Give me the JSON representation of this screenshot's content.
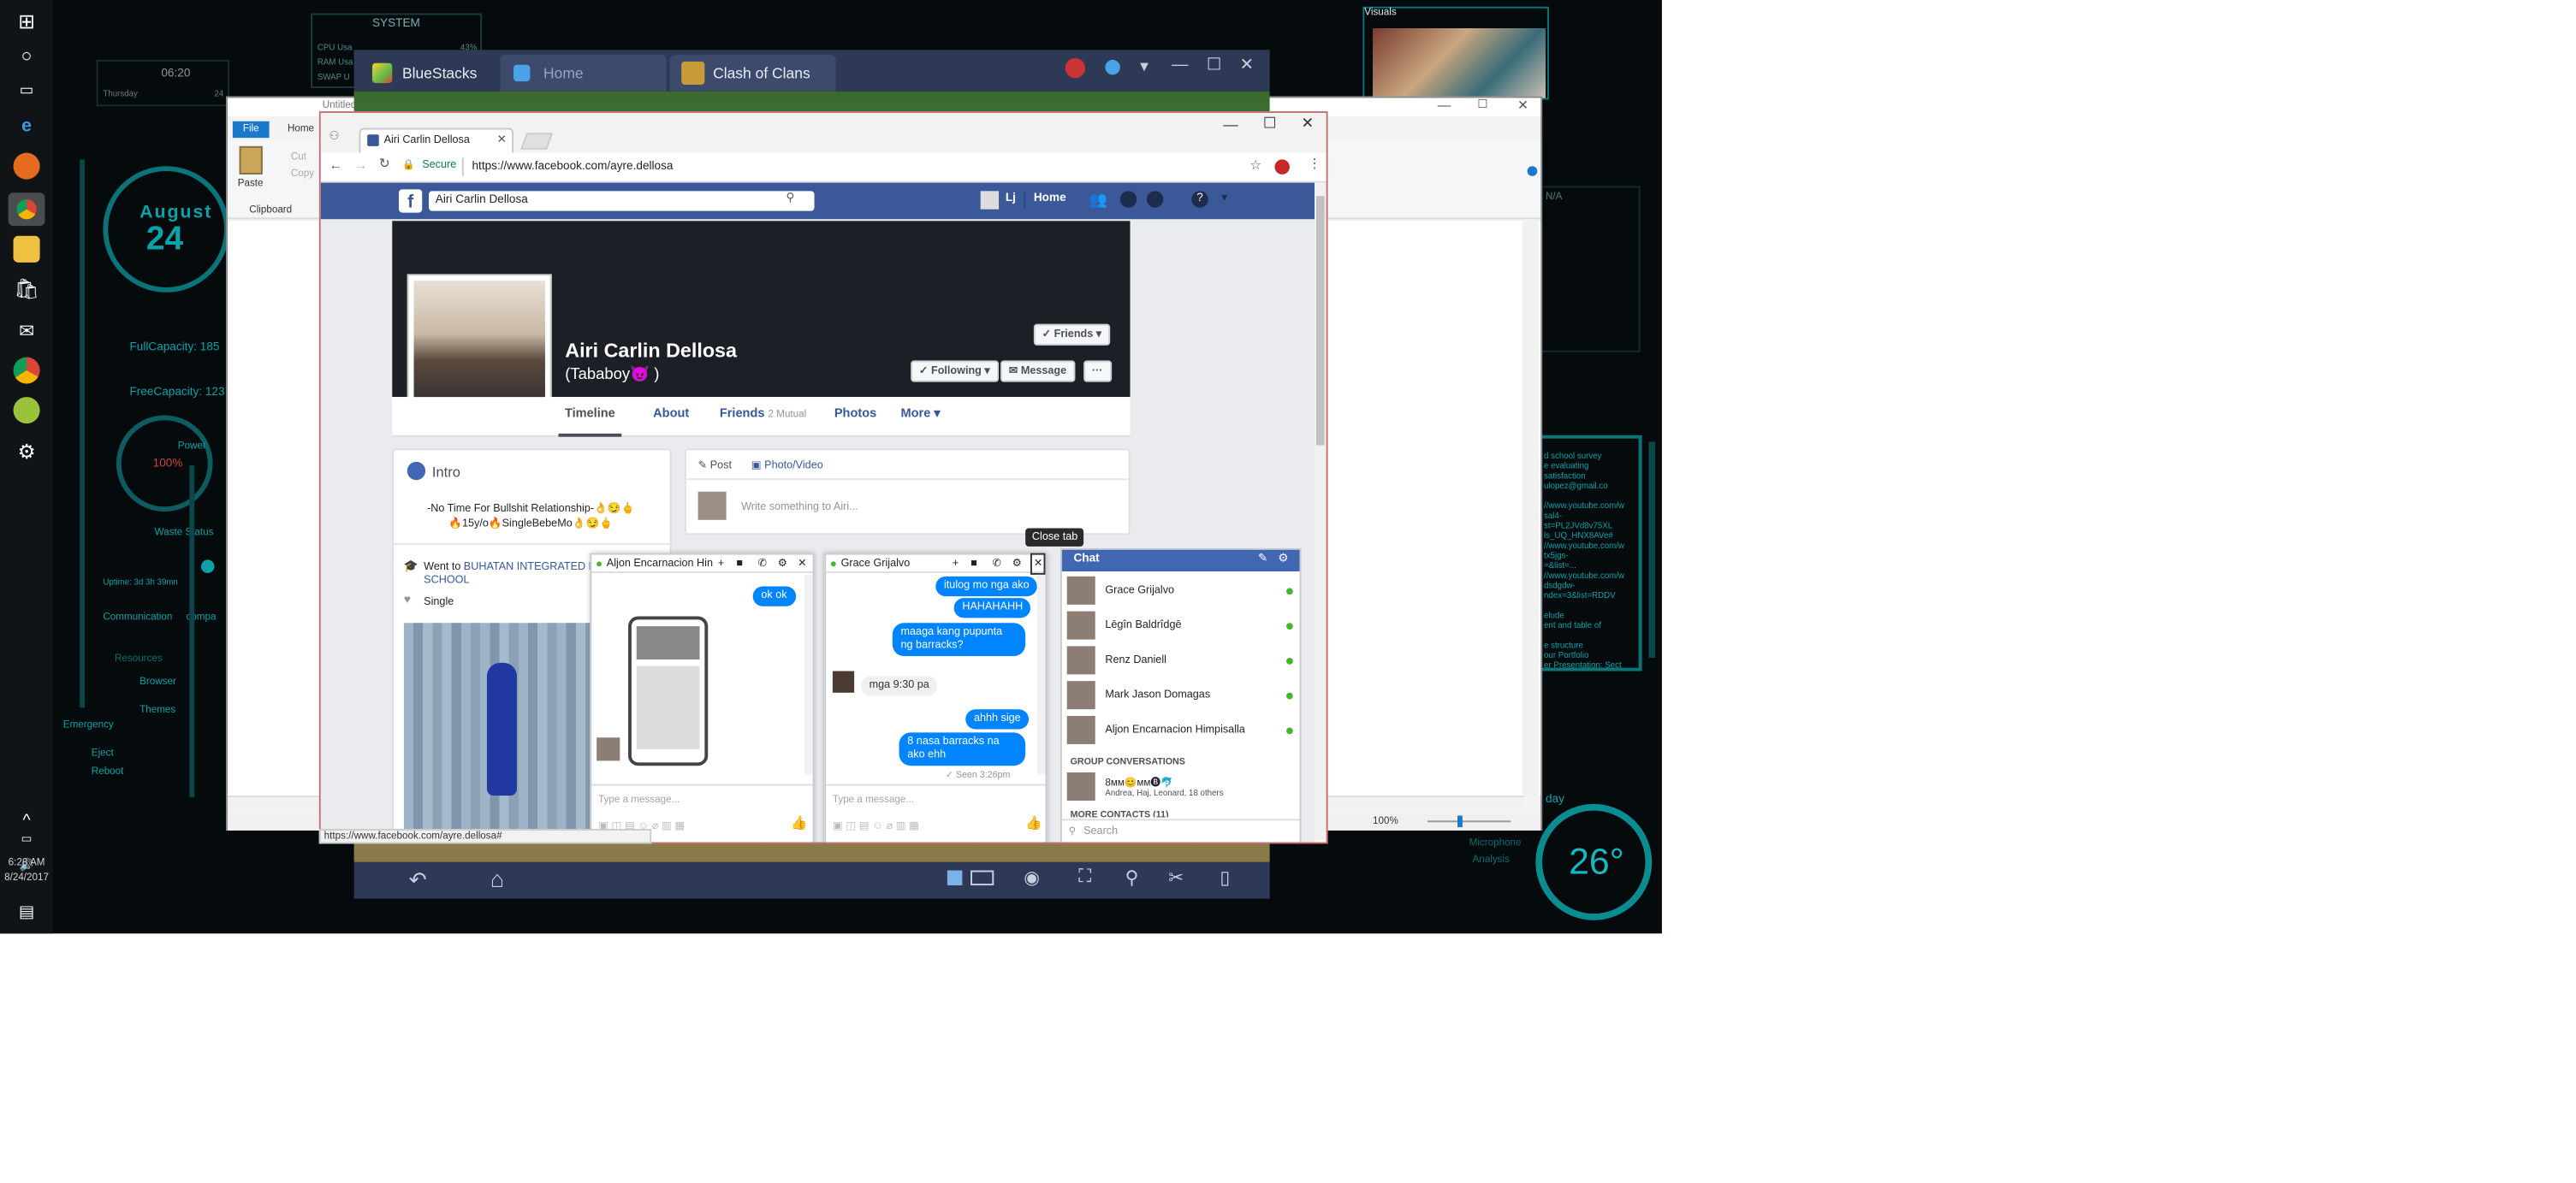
{
  "desktop": {
    "hud_system_title": "SYSTEM",
    "hud_cpu": "CPU Usa",
    "hud_ram": "RAM Usa",
    "hud_swap": "SWAP U",
    "hud_cpu_val": "43%",
    "hud_clock": "06:20",
    "hud_day": "Thursday",
    "hud_day_num": "24",
    "hud_month": "August",
    "hud_date_big": "24",
    "hud_full_capacity": "FullCapacity: 185",
    "hud_free_capacity": "FreeCapacity: 123",
    "hud_power": "Power",
    "hud_power_val": "100%",
    "hud_waste_status": "Waste Status",
    "hud_uptime": "Uptime: 3d 3h 39mn",
    "hud_communication": "Communication",
    "hud_comp": "compa",
    "hud_resources": "Resources",
    "hud_browser": "Browser",
    "hud_themes": "Themes",
    "hud_emergency": "Emergency",
    "hud_eject": "Eject",
    "hud_reboot": "Reboot",
    "hud_visuals": "Visuals",
    "hud_temp": "26°",
    "hud_microphone": "Microphone",
    "hud_analysis": "Analysis",
    "hud_na": "N/A",
    "hud_notes": [
      "d school survey",
      "e evaluating",
      "satisfaction",
      "ulopez@gmail.co",
      "",
      "//www.youtube.com/w",
      "sal4-",
      "st=PL2JVd8v75XL",
      "ls_UQ_HNX8AVe#",
      "//www.youtube.com/w",
      "tx5jgs-",
      "=&list=...",
      "//www.youtube.com/w",
      "dsdgdw-",
      "ndex=3&list=RDDV",
      "",
      "elude",
      "ent and table of",
      "",
      "e structure",
      "our Portfolio",
      "er Presentation; Sect"
    ],
    "hud_day_label": "day"
  },
  "taskbar": {
    "time": "6:28 AM",
    "date": "8/24/2017",
    "icons": [
      "windows-icon",
      "cortana-icon",
      "task-view-icon",
      "edge-icon",
      "firefox-icon",
      "chrome-icon",
      "file-explorer-icon",
      "store-icon",
      "mail-icon",
      "chrome-app-icon",
      "bluestacks-icon",
      "settings-icon"
    ]
  },
  "paint": {
    "title": "Untitled - Paint",
    "tab_file": "File",
    "tab_home": "Home",
    "paste": "Paste",
    "cut": "Cut",
    "copy": "Copy",
    "clipboard": "Clipboard",
    "zoom": "100%"
  },
  "bluestacks": {
    "app_name": "BlueStacks",
    "tab_home": "Home",
    "tab_game": "Clash of Clans"
  },
  "chrome": {
    "tab_title": "Airi Carlin Dellosa",
    "secure": "Secure",
    "url": "https://www.facebook.com/ayre.dellosa",
    "status_url": "https://www.facebook.com/ayre.dellosa#"
  },
  "facebook": {
    "search_value": "Airi Carlin Dellosa",
    "user_short": "Lj",
    "home": "Home",
    "profile_name": "Airi Carlin Dellosa",
    "nickname": "(Tababoy😈 )",
    "friends_btn": "Friends",
    "following_btn": "Following",
    "message_btn": "Message",
    "more_dots": "···",
    "nav": {
      "timeline": "Timeline",
      "about": "About",
      "friends": "Friends",
      "mutual": "2 Mutual",
      "photos": "Photos",
      "more": "More"
    },
    "intro_title": "Intro",
    "intro_text_1": "-No Time For Bullshit Relationship-👌😏🖕",
    "intro_text_2": "🔥15y/o🔥SingleBebeMo👌😏🖕",
    "went_to": "Went to",
    "school": "BUHATAN INTEGRATED N",
    "school_2": "SCHOOL",
    "relationship": "Single",
    "post_tab": "Post",
    "photo_video_tab": "Photo/Video",
    "composer_placeholder": "Write something to Airi...",
    "close_tab_tooltip": "Close tab"
  },
  "chat1": {
    "name": "Aljon Encarnacion Hin",
    "msg_ok": "ok ok",
    "input_placeholder": "Type a message..."
  },
  "chat2": {
    "name": "Grace Grijalvo",
    "m1": "itulog mo nga ako",
    "m2": "HAHAHAHH",
    "m3": "maaga kang pupunta ng barracks?",
    "m4": "mga 9:30 pa",
    "m5": "ahhh sige",
    "m6": "8 nasa barracks na ako ehh",
    "seen": "✓ Seen 3:26pm",
    "input_placeholder": "Type a message..."
  },
  "chat_sidebar": {
    "title": "Chat",
    "contacts": [
      "Grace Grijalvo",
      "Lēgîn Baldrîdgē",
      "Renz Daniell",
      "Mark Jason Domagas",
      "Aljon Encarnacion Himpisalla"
    ],
    "group_header": "GROUP CONVERSATIONS",
    "group_name": "8ᴍᴍ😊ᴍᴍ🅑🐬",
    "group_members": "Andrea, Haj, Leonard, 18 others",
    "more_header": "MORE CONTACTS (11)",
    "search_placeholder": "Search"
  },
  "colors": {
    "fb_blue": "#3b5998",
    "messenger_blue": "#0084ff",
    "hud_cyan": "#0aa3a8",
    "bluestacks_navy": "#2e3a55",
    "online_green": "#42b72a"
  }
}
